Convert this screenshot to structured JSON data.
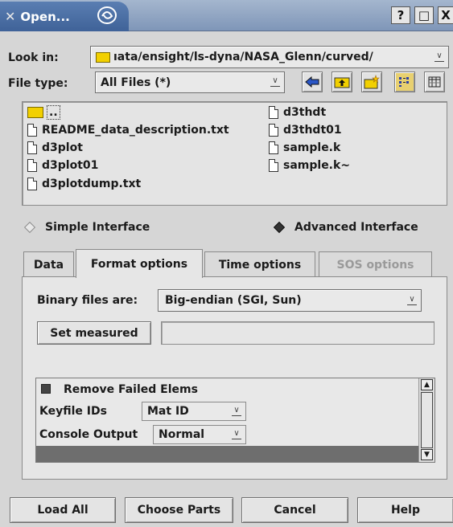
{
  "window": {
    "title": "Open...",
    "title_icon": "x-close-glyph",
    "buttons": {
      "help": "?",
      "maximize": "□",
      "close": "X"
    }
  },
  "look_in": {
    "label": "Look in:",
    "path": "ıata/ensight/ls-dyna/NASA_Glenn/curved/"
  },
  "file_type": {
    "label": "File type:",
    "value": "All Files (*)"
  },
  "toolbar_icons": [
    "back-arrow-icon",
    "up-folder-icon",
    "new-folder-icon",
    "list-view-icon",
    "detail-view-icon"
  ],
  "files": {
    "col1": [
      "..",
      "README_data_description.txt",
      "d3plot",
      "d3plot01",
      "d3plotdump.txt"
    ],
    "col2": [
      "d3thdt",
      "d3thdt01",
      "sample.k",
      "sample.k~"
    ]
  },
  "interface": {
    "simple": "Simple Interface",
    "advanced": "Advanced Interface",
    "selected": "advanced"
  },
  "tabs": [
    {
      "label": "Data",
      "state": "normal"
    },
    {
      "label": "Format options",
      "state": "active"
    },
    {
      "label": "Time options",
      "state": "normal"
    },
    {
      "label": "SOS options",
      "state": "disabled"
    }
  ],
  "format": {
    "binary_label": "Binary files are:",
    "binary_value": "Big-endian (SGI, Sun)",
    "set_measured": "Set measured",
    "measured_value": "",
    "remove_failed": "Remove Failed Elems",
    "remove_failed_checked": true,
    "keyfile_label": "Keyfile IDs",
    "keyfile_value": "Mat ID",
    "console_label": "Console Output",
    "console_value": "Normal"
  },
  "buttons": {
    "load_all": "Load All",
    "choose_parts": "Choose Parts",
    "cancel": "Cancel",
    "help": "Help"
  },
  "colors": {
    "titlebar": "#7f96b8",
    "title_tab": "#4a6ea5",
    "folder": "#f2d000",
    "background": "#d6d6d6"
  }
}
